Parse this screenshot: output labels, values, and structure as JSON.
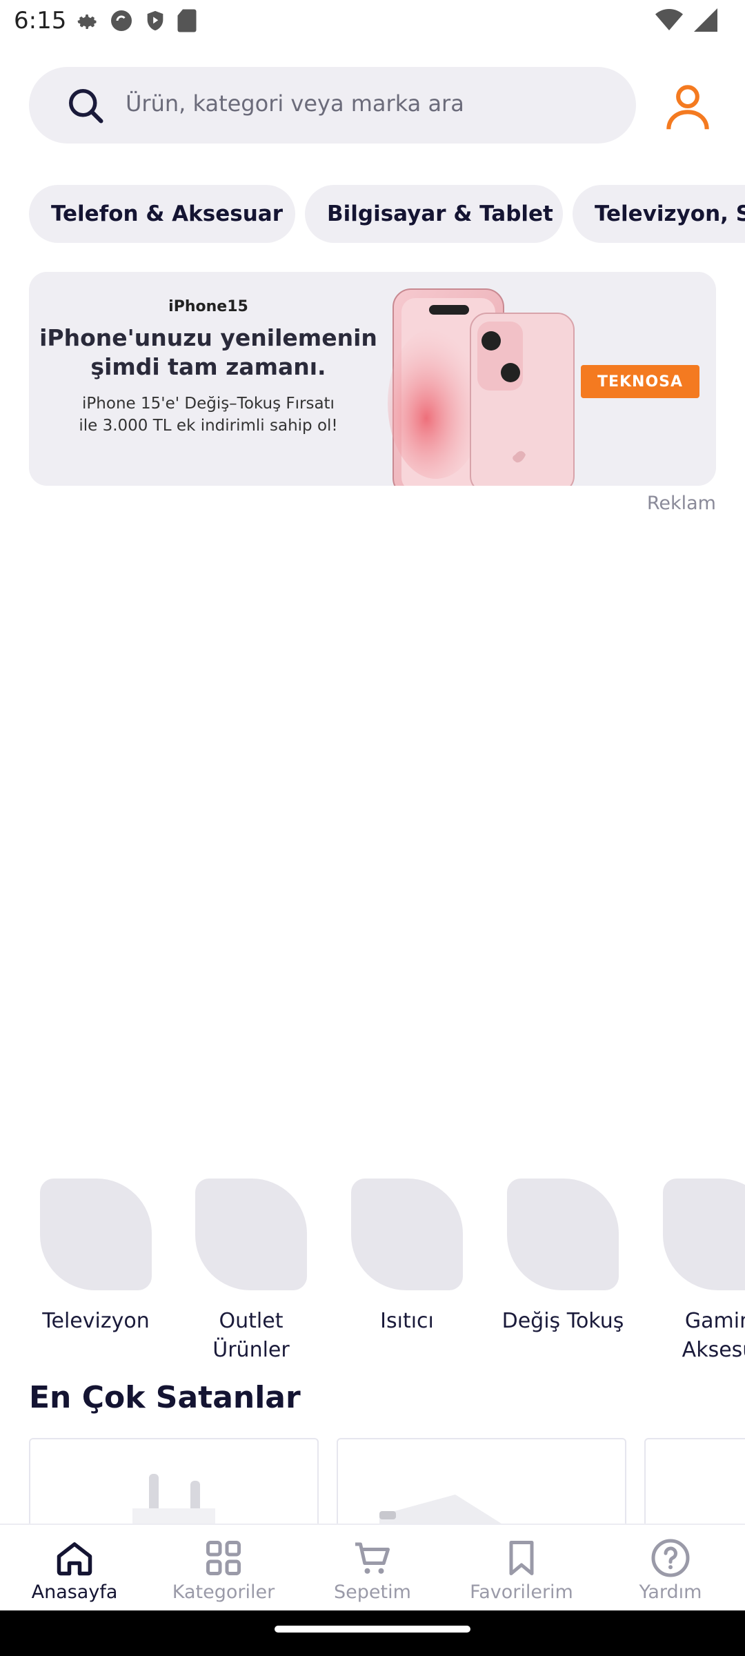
{
  "status_bar": {
    "time": "6:15"
  },
  "search": {
    "placeholder": "Ürün, kategori veya marka ara"
  },
  "category_chips": [
    {
      "label": "Telefon & Aksesuar"
    },
    {
      "label": "Bilgisayar & Tablet"
    },
    {
      "label": "Televizyon, S"
    }
  ],
  "banner": {
    "brand_line": "iPhone15",
    "headline_1": "iPhone'unuzu yenilemenin",
    "headline_2": "şimdi tam zamanı.",
    "subline_1": "iPhone 15'e' Değiş–Tokuş Fırsatı",
    "subline_2": "ile 3.000 TL ek indirimli sahip ol!",
    "logo_text": "TEKNOSA",
    "ad_label": "Reklam"
  },
  "shortcuts": [
    {
      "label": "Televizyon"
    },
    {
      "label": "Outlet\nÜrünler"
    },
    {
      "label": "Isıtıcı"
    },
    {
      "label": "Değiş Tokuş"
    },
    {
      "label": "Gamin\nAksesu"
    }
  ],
  "best_sellers": {
    "title": "En Çok Satanlar"
  },
  "bottom_nav": [
    {
      "label": "Anasayfa",
      "icon": "home-icon",
      "active": true
    },
    {
      "label": "Kategoriler",
      "icon": "grid-icon",
      "active": false
    },
    {
      "label": "Sepetim",
      "icon": "cart-icon",
      "active": false
    },
    {
      "label": "Favorilerim",
      "icon": "bookmark-icon",
      "active": false
    },
    {
      "label": "Yardım",
      "icon": "help-icon",
      "active": false
    }
  ],
  "colors": {
    "accent": "#f47a20",
    "chip_bg": "#efeef3",
    "text_dark": "#141432"
  }
}
